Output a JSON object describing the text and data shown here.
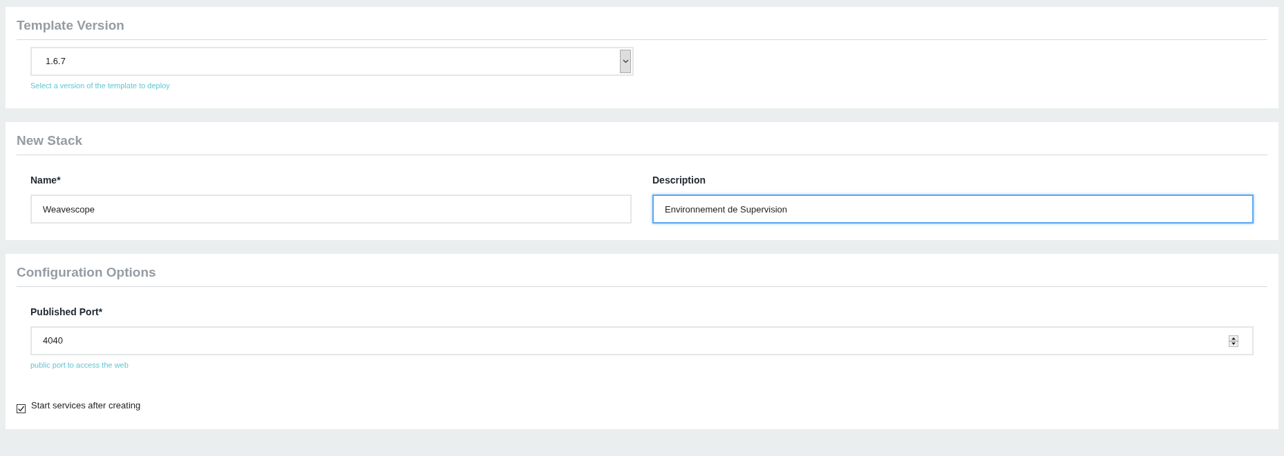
{
  "sections": [
    {
      "title": "Template Version",
      "fields": [
        {
          "kind": "select",
          "value": "1.6.7",
          "help": "Select a version of the template to deploy",
          "focused": false
        }
      ]
    },
    {
      "title": "New Stack",
      "fields": [
        {
          "kind": "text",
          "label": "Name*",
          "value": "Weavescope",
          "focused": false
        },
        {
          "kind": "text",
          "label": "Description",
          "value": "Environnement de Supervision",
          "focused": true
        }
      ]
    },
    {
      "title": "Configuration Options",
      "fields": [
        {
          "kind": "number",
          "label": "Published Port*",
          "value": "4040",
          "help": "public port to access the web",
          "focused": false
        }
      ],
      "checkbox": {
        "label": "Start services after creating",
        "checked": true
      }
    }
  ]
}
